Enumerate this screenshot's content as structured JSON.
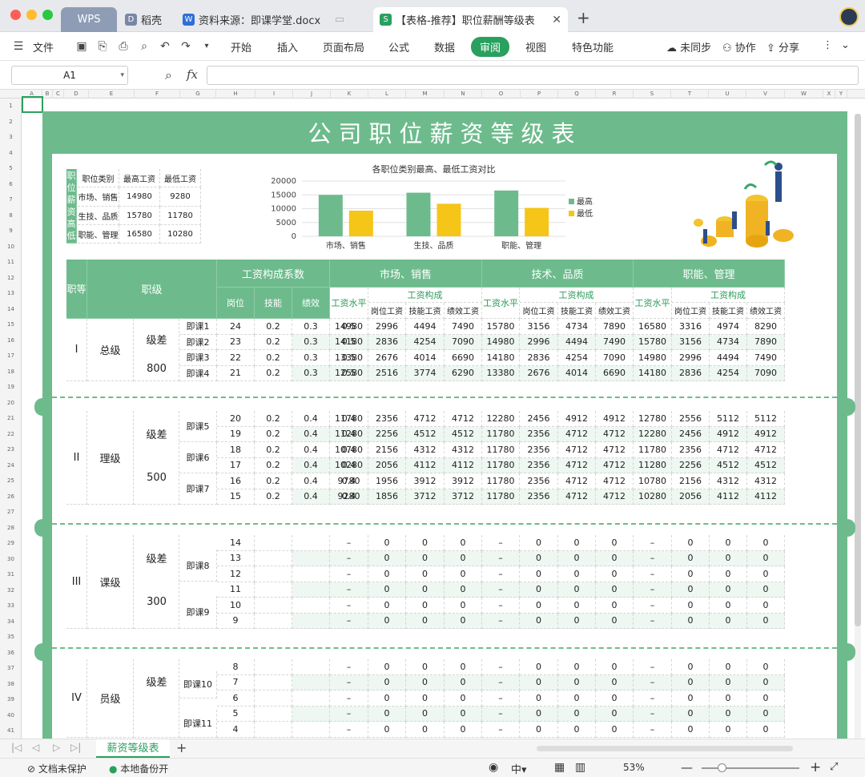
{
  "window": {
    "tabs": [
      {
        "label": "WPS"
      },
      {
        "label": "稻壳"
      },
      {
        "label": "资料来源：即课学堂.docx"
      },
      {
        "label": "【表格-推荐】职位薪酬等级表"
      }
    ]
  },
  "menu": {
    "file": "文件",
    "items": [
      "开始",
      "插入",
      "页面布局",
      "公式",
      "数据",
      "审阅",
      "视图",
      "特色功能"
    ],
    "active": "审阅",
    "sync": "未同步",
    "collab": "协作",
    "share": "分享"
  },
  "formula": {
    "cell_ref": "A1",
    "fx": "fx",
    "content": ""
  },
  "columns": [
    "A",
    "B",
    "C",
    "D",
    "E",
    "F",
    "G",
    "H",
    "I",
    "J",
    "K",
    "L",
    "M",
    "N",
    "O",
    "P",
    "Q",
    "R",
    "S",
    "T",
    "U",
    "V",
    "W",
    "X",
    "Y"
  ],
  "sheet": {
    "title": "公司职位薪资等级表",
    "summary": {
      "side_label": "职位薪资高低",
      "headers": [
        "职位类别",
        "最高工资",
        "最低工资"
      ],
      "rows": [
        [
          "市场、销售",
          "14980",
          "9280"
        ],
        [
          "生技、品质",
          "15780",
          "11780"
        ],
        [
          "职能、管理",
          "16580",
          "10280"
        ]
      ]
    },
    "headers": {
      "rank": "职等",
      "level": "职级",
      "coef": "工资构成系数",
      "coef_cols": [
        "岗位",
        "技能",
        "绩效"
      ],
      "groups": [
        "市场、销售",
        "技术、品质",
        "职能、管理"
      ],
      "wage_level": "工资水平",
      "composition": "工资构成",
      "comp_cols": [
        "岗位工资",
        "技能工资",
        "绩效工资"
      ]
    },
    "dash": "–",
    "blocks": [
      {
        "rank": "I",
        "level": "总级",
        "diff_label": "级差",
        "diff": "800",
        "rows": [
          {
            "sub": "即课1",
            "n": "24",
            "coef": [
              "0.2",
              "0.3",
              "0.5"
            ],
            "g": [
              [
                "14980",
                "2996",
                "4494",
                "7490"
              ],
              [
                "15780",
                "3156",
                "4734",
                "7890"
              ],
              [
                "16580",
                "3316",
                "4974",
                "8290"
              ]
            ]
          },
          {
            "sub": "即课2",
            "n": "23",
            "coef": [
              "0.2",
              "0.3",
              "0.5"
            ],
            "g": [
              [
                "14180",
                "2836",
                "4254",
                "7090"
              ],
              [
                "14980",
                "2996",
                "4494",
                "7490"
              ],
              [
                "15780",
                "3156",
                "4734",
                "7890"
              ]
            ]
          },
          {
            "sub": "即课3",
            "n": "22",
            "coef": [
              "0.2",
              "0.3",
              "0.5"
            ],
            "g": [
              [
                "13380",
                "2676",
                "4014",
                "6690"
              ],
              [
                "14180",
                "2836",
                "4254",
                "7090"
              ],
              [
                "14980",
                "2996",
                "4494",
                "7490"
              ]
            ]
          },
          {
            "sub": "即课4",
            "n": "21",
            "coef": [
              "0.2",
              "0.3",
              "0.5"
            ],
            "g": [
              [
                "12580",
                "2516",
                "3774",
                "6290"
              ],
              [
                "13380",
                "2676",
                "4014",
                "6690"
              ],
              [
                "14180",
                "2836",
                "4254",
                "7090"
              ]
            ]
          }
        ]
      },
      {
        "rank": "II",
        "level": "理级",
        "diff_label": "级差",
        "diff": "500",
        "subs": [
          "即课5",
          "即课6",
          "即课7"
        ],
        "rows": [
          {
            "n": "20",
            "coef": [
              "0.2",
              "0.4",
              "0.4"
            ],
            "g": [
              [
                "11780",
                "2356",
                "4712",
                "4712"
              ],
              [
                "12280",
                "2456",
                "4912",
                "4912"
              ],
              [
                "12780",
                "2556",
                "5112",
                "5112"
              ]
            ]
          },
          {
            "n": "19",
            "coef": [
              "0.2",
              "0.4",
              "0.4"
            ],
            "g": [
              [
                "11280",
                "2256",
                "4512",
                "4512"
              ],
              [
                "11780",
                "2356",
                "4712",
                "4712"
              ],
              [
                "12280",
                "2456",
                "4912",
                "4912"
              ]
            ]
          },
          {
            "n": "18",
            "coef": [
              "0.2",
              "0.4",
              "0.4"
            ],
            "g": [
              [
                "10780",
                "2156",
                "4312",
                "4312"
              ],
              [
                "11780",
                "2356",
                "4712",
                "4712"
              ],
              [
                "11780",
                "2356",
                "4712",
                "4712"
              ]
            ]
          },
          {
            "n": "17",
            "coef": [
              "0.2",
              "0.4",
              "0.4"
            ],
            "g": [
              [
                "10280",
                "2056",
                "4112",
                "4112"
              ],
              [
                "11780",
                "2356",
                "4712",
                "4712"
              ],
              [
                "11280",
                "2256",
                "4512",
                "4512"
              ]
            ]
          },
          {
            "n": "16",
            "coef": [
              "0.2",
              "0.4",
              "0.4"
            ],
            "g": [
              [
                "9780",
                "1956",
                "3912",
                "3912"
              ],
              [
                "11780",
                "2356",
                "4712",
                "4712"
              ],
              [
                "10780",
                "2156",
                "4312",
                "4312"
              ]
            ]
          },
          {
            "n": "15",
            "coef": [
              "0.2",
              "0.4",
              "0.4"
            ],
            "g": [
              [
                "9280",
                "1856",
                "3712",
                "3712"
              ],
              [
                "11780",
                "2356",
                "4712",
                "4712"
              ],
              [
                "10280",
                "2056",
                "4112",
                "4112"
              ]
            ]
          }
        ]
      },
      {
        "rank": "III",
        "level": "课级",
        "diff_label": "级差",
        "diff": "300",
        "subs": [
          "即课8",
          "即课9"
        ],
        "nums": [
          "14",
          "13",
          "12",
          "11",
          "10",
          "9"
        ]
      },
      {
        "rank": "IV",
        "level": "员级",
        "diff_label": "级差",
        "diff": "",
        "subs": [
          "即课10",
          "即课11"
        ],
        "nums": [
          "8",
          "7",
          "6",
          "5",
          "4"
        ]
      }
    ]
  },
  "chart_data": {
    "type": "bar",
    "title": "各职位类别最高、最低工资对比",
    "categories": [
      "市场、销售",
      "生技、品质",
      "职能、管理"
    ],
    "series": [
      {
        "name": "最高工资",
        "values": [
          14980,
          15780,
          16580
        ],
        "color": "#6dbb8c"
      },
      {
        "name": "最低工资",
        "values": [
          9280,
          11780,
          10280
        ],
        "color": "#f5c518"
      }
    ],
    "ylim": [
      0,
      20000
    ],
    "yticks": [
      "0",
      "5000",
      "10000",
      "15000",
      "20000"
    ],
    "legend": "right",
    "grid": true
  },
  "sheet_tabs": {
    "active": "薪资等级表",
    "add": "+"
  },
  "status": {
    "protect": "文档未保护",
    "backup": "本地备份开",
    "zoom": "53%"
  },
  "colors": {
    "accent": "#6dbb8c",
    "alt_row": "#eef7f1",
    "yellow": "#f5c518"
  }
}
